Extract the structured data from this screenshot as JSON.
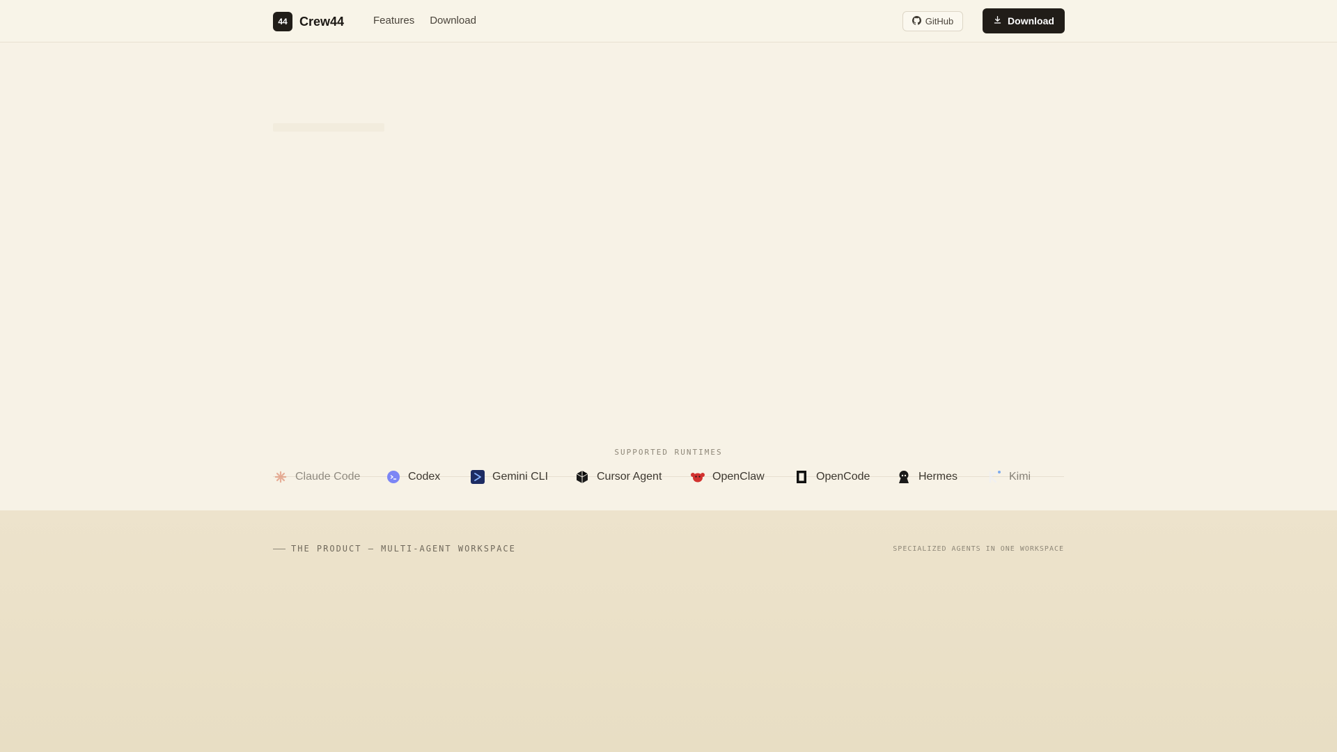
{
  "brand": {
    "mark": "44",
    "name": "Crew44"
  },
  "nav": {
    "features": "Features",
    "download": "Download"
  },
  "header": {
    "github_label": "GitHub",
    "download_label": "Download"
  },
  "runtimes": {
    "title": "SUPPORTED RUNTIMES",
    "items": [
      {
        "label": "Claude Code",
        "icon": "claude-icon"
      },
      {
        "label": "Codex",
        "icon": "codex-icon"
      },
      {
        "label": "Gemini CLI",
        "icon": "gemini-cli-icon"
      },
      {
        "label": "Cursor Agent",
        "icon": "cursor-icon"
      },
      {
        "label": "OpenClaw",
        "icon": "openclaw-icon"
      },
      {
        "label": "OpenCode",
        "icon": "opencode-icon"
      },
      {
        "label": "Hermes",
        "icon": "hermes-icon"
      },
      {
        "label": "Kimi",
        "icon": "kimi-icon"
      }
    ]
  },
  "product_section": {
    "label": "THE PRODUCT — MULTI-AGENT WORKSPACE",
    "right_label": "SPECIALIZED AGENTS IN ONE WORKSPACE"
  }
}
